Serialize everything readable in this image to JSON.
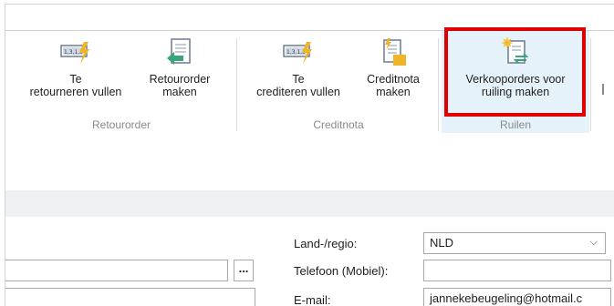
{
  "ribbon": {
    "buttons": [
      {
        "label_line1": "Te",
        "label_line2": "retourneren vullen",
        "icon": "fill-lightning-icon"
      },
      {
        "label_line1": "Retourorder",
        "label_line2": "maken",
        "icon": "return-order-icon"
      },
      {
        "label_line1": "Te",
        "label_line2": "crediteren vullen",
        "icon": "fill-lightning-icon"
      },
      {
        "label_line1": "Creditnota",
        "label_line2": "maken",
        "icon": "credit-note-icon"
      },
      {
        "label_line1": "Verkooporders voor",
        "label_line2": "ruiling maken",
        "icon": "exchange-order-icon"
      }
    ],
    "groups": [
      {
        "label": "Retourorder"
      },
      {
        "label": "Creditnota"
      },
      {
        "label": "Ruilen"
      }
    ],
    "highlight_color": "#e00000"
  },
  "form": {
    "dots_label": "...",
    "land_label": "Land-/regio:",
    "land_value": "NLD",
    "tel_label": "Telefoon (Mobiel):",
    "tel_value": "",
    "email_label": "E-mail:",
    "email_value": "jannekebeugeling@hotmail.c"
  }
}
